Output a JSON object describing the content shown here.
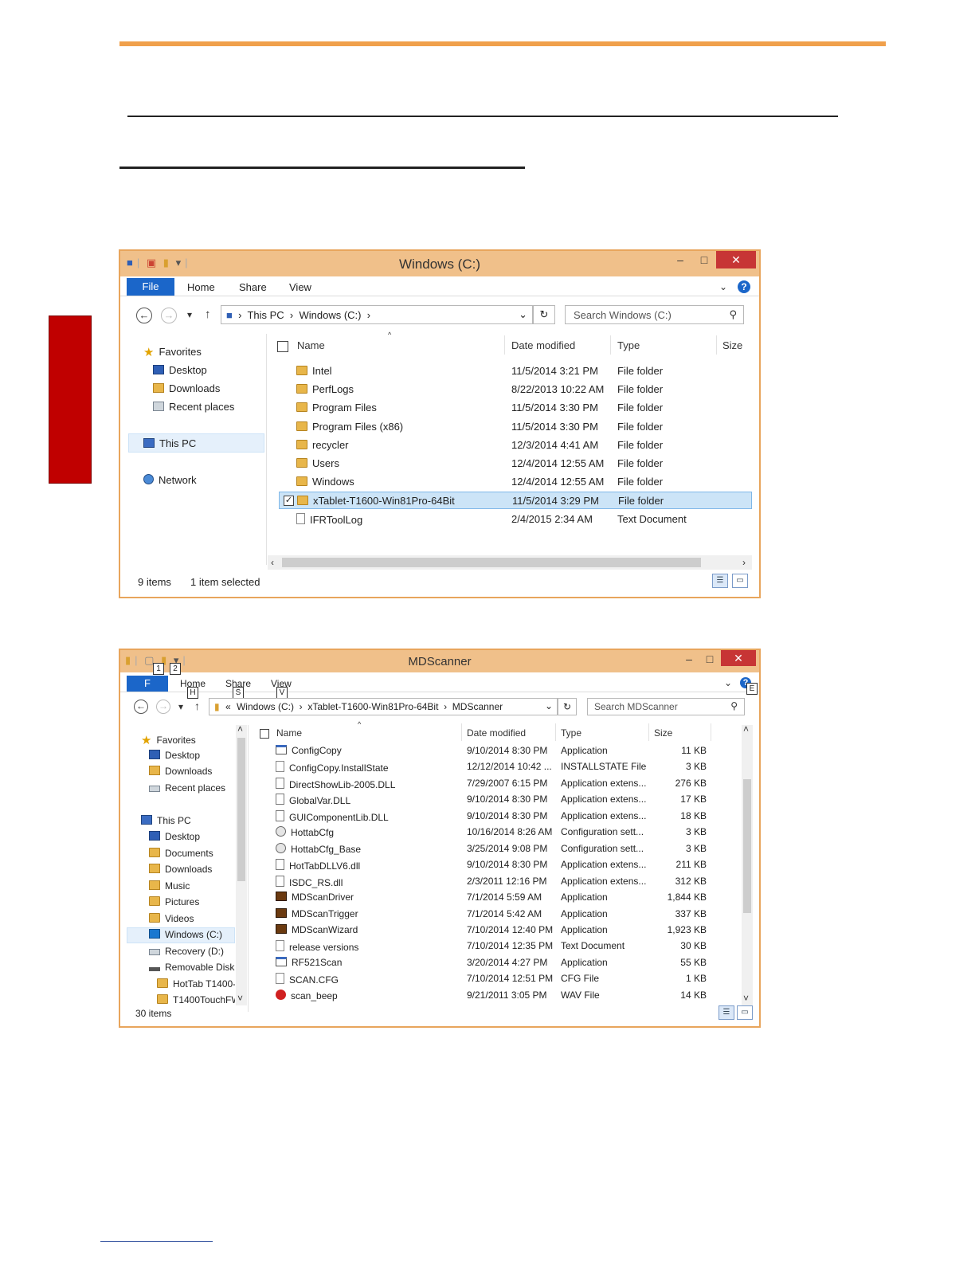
{
  "window1": {
    "title": "Windows (C:)",
    "ribbon_tabs": [
      "File",
      "Home",
      "Share",
      "View"
    ],
    "address": {
      "segments": [
        "This PC",
        "Windows (C:)"
      ]
    },
    "search_placeholder": "Search Windows (C:)",
    "nav": {
      "favorites": "Favorites",
      "desktop": "Desktop",
      "downloads": "Downloads",
      "recent": "Recent places",
      "this_pc": "This PC",
      "network": "Network"
    },
    "columns": [
      "Name",
      "Date modified",
      "Type",
      "Size"
    ],
    "rows": [
      {
        "name": "Intel",
        "date": "11/5/2014 3:21 PM",
        "type": "File folder",
        "icon": "folder-icon"
      },
      {
        "name": "PerfLogs",
        "date": "8/22/2013 10:22 AM",
        "type": "File folder",
        "icon": "folder-icon"
      },
      {
        "name": "Program Files",
        "date": "11/5/2014 3:30 PM",
        "type": "File folder",
        "icon": "folder-icon"
      },
      {
        "name": "Program Files (x86)",
        "date": "11/5/2014 3:30 PM",
        "type": "File folder",
        "icon": "folder-icon"
      },
      {
        "name": "recycler",
        "date": "12/3/2014 4:41 AM",
        "type": "File folder",
        "icon": "folder-icon"
      },
      {
        "name": "Users",
        "date": "12/4/2014 12:55 AM",
        "type": "File folder",
        "icon": "folder-icon"
      },
      {
        "name": "Windows",
        "date": "12/4/2014 12:55 AM",
        "type": "File folder",
        "icon": "folder-icon"
      },
      {
        "name": "xTablet-T1600-Win81Pro-64Bit",
        "date": "11/5/2014 3:29 PM",
        "type": "File folder",
        "icon": "folder-icon",
        "selected": true
      },
      {
        "name": "IFRToolLog",
        "date": "2/4/2015 2:34 AM",
        "type": "Text Document",
        "icon": "text-document-icon"
      }
    ],
    "status": {
      "count": "9 items",
      "selection": "1 item selected"
    }
  },
  "window2": {
    "title": "MDScanner",
    "ribbon_tabs": [
      "F",
      "Home",
      "Share",
      "View"
    ],
    "keytips": {
      "qa1": "1",
      "qa2": "2",
      "home": "H",
      "share": "S",
      "view": "V",
      "help": "E"
    },
    "address": {
      "prefix": "«",
      "segments": [
        "Windows (C:)",
        "xTablet-T1600-Win81Pro-64Bit",
        "MDScanner"
      ]
    },
    "search_placeholder": "Search MDScanner",
    "nav": [
      {
        "label": "Favorites",
        "icon": "star-icon",
        "indent": 0
      },
      {
        "label": "Desktop",
        "icon": "desktop-icon",
        "indent": 1
      },
      {
        "label": "Downloads",
        "icon": "downloads-icon",
        "indent": 1
      },
      {
        "label": "Recent places",
        "icon": "recent-places-icon",
        "indent": 1
      },
      {
        "label": "",
        "icon": "",
        "indent": 0
      },
      {
        "label": "This PC",
        "icon": "computer-icon",
        "indent": 0
      },
      {
        "label": "Desktop",
        "icon": "desktop-icon",
        "indent": 1
      },
      {
        "label": "Documents",
        "icon": "documents-icon",
        "indent": 1
      },
      {
        "label": "Downloads",
        "icon": "downloads-icon",
        "indent": 1
      },
      {
        "label": "Music",
        "icon": "music-icon",
        "indent": 1
      },
      {
        "label": "Pictures",
        "icon": "pictures-icon",
        "indent": 1
      },
      {
        "label": "Videos",
        "icon": "videos-icon",
        "indent": 1
      },
      {
        "label": "Windows (C:)",
        "icon": "windows-drive-icon",
        "indent": 1,
        "selected": true
      },
      {
        "label": "Recovery (D:)",
        "icon": "drive-icon",
        "indent": 1
      },
      {
        "label": "Removable Disk (",
        "icon": "removable-disk-icon",
        "indent": 1
      },
      {
        "label": "HotTab T1400-",
        "icon": "folder-icon",
        "indent": 2
      },
      {
        "label": "T1400TouchFW",
        "icon": "folder-icon",
        "indent": 2
      }
    ],
    "columns": [
      "Name",
      "Date modified",
      "Type",
      "Size"
    ],
    "rows": [
      {
        "name": "ConfigCopy",
        "date": "9/10/2014 8:30 PM",
        "type": "Application",
        "size": "11 KB",
        "icon": "application-icon"
      },
      {
        "name": "ConfigCopy.InstallState",
        "date": "12/12/2014 10:42 ...",
        "type": "INSTALLSTATE File",
        "size": "3 KB",
        "icon": "file-icon"
      },
      {
        "name": "DirectShowLib-2005.DLL",
        "date": "7/29/2007 6:15 PM",
        "type": "Application extens...",
        "size": "276 KB",
        "icon": "dll-icon"
      },
      {
        "name": "GlobalVar.DLL",
        "date": "9/10/2014 8:30 PM",
        "type": "Application extens...",
        "size": "17 KB",
        "icon": "dll-icon"
      },
      {
        "name": "GUIComponentLib.DLL",
        "date": "9/10/2014 8:30 PM",
        "type": "Application extens...",
        "size": "18 KB",
        "icon": "dll-icon"
      },
      {
        "name": "HottabCfg",
        "date": "10/16/2014 8:26 AM",
        "type": "Configuration sett...",
        "size": "3 KB",
        "icon": "config-icon"
      },
      {
        "name": "HottabCfg_Base",
        "date": "3/25/2014 9:08 PM",
        "type": "Configuration sett...",
        "size": "3 KB",
        "icon": "config-icon"
      },
      {
        "name": "HotTabDLLV6.dll",
        "date": "9/10/2014 8:30 PM",
        "type": "Application extens...",
        "size": "211 KB",
        "icon": "dll-icon"
      },
      {
        "name": "ISDC_RS.dll",
        "date": "2/3/2011 12:16 PM",
        "type": "Application extens...",
        "size": "312 KB",
        "icon": "dll-icon"
      },
      {
        "name": "MDScanDriver",
        "date": "7/1/2014 5:59 AM",
        "type": "Application",
        "size": "1,844 KB",
        "icon": "mdscanner-app-icon"
      },
      {
        "name": "MDScanTrigger",
        "date": "7/1/2014 5:42 AM",
        "type": "Application",
        "size": "337 KB",
        "icon": "mdscanner-app-icon"
      },
      {
        "name": "MDScanWizard",
        "date": "7/10/2014 12:40 PM",
        "type": "Application",
        "size": "1,923 KB",
        "icon": "mdscanner-app-icon"
      },
      {
        "name": "release versions",
        "date": "7/10/2014 12:35 PM",
        "type": "Text Document",
        "size": "30 KB",
        "icon": "text-document-icon"
      },
      {
        "name": "RF521Scan",
        "date": "3/20/2014 4:27 PM",
        "type": "Application",
        "size": "55 KB",
        "icon": "application-icon"
      },
      {
        "name": "SCAN.CFG",
        "date": "7/10/2014 12:51 PM",
        "type": "CFG File",
        "size": "1 KB",
        "icon": "file-icon"
      },
      {
        "name": "scan_beep",
        "date": "9/21/2011 3:05 PM",
        "type": "WAV File",
        "size": "14 KB",
        "icon": "audio-file-icon"
      }
    ],
    "status": {
      "count": "30 items"
    }
  }
}
